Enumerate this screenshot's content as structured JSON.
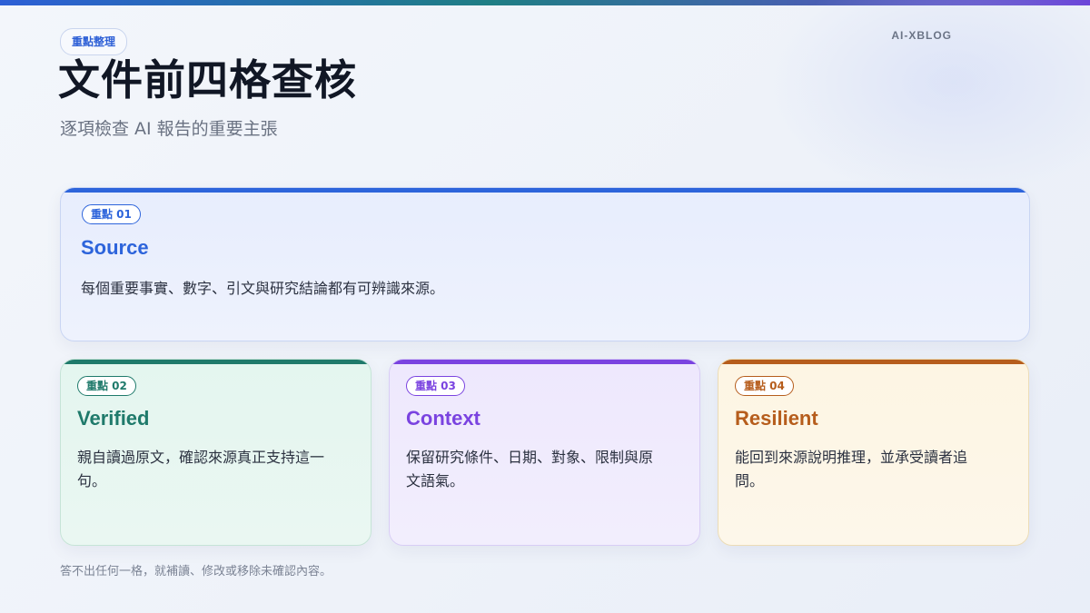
{
  "brand": "AI-XBLOG",
  "header": {
    "tag": "重點整理",
    "title": "文件前四格查核",
    "subtitle": "逐項檢查 AI 報告的重要主張"
  },
  "cards": [
    {
      "badge": "重點 01",
      "title": "Source",
      "desc": "每個重要事實、數字、引文與研究結論都有可辨識來源。",
      "color": "#2d64db"
    },
    {
      "badge": "重點 02",
      "title": "Verified",
      "desc": "親自讀過原文，確認來源真正支持這一句。",
      "color": "#1f7a6b"
    },
    {
      "badge": "重點 03",
      "title": "Context",
      "desc": "保留研究條件、日期、對象、限制與原文語氣。",
      "color": "#7a43e0"
    },
    {
      "badge": "重點 04",
      "title": "Resilient",
      "desc": "能回到來源說明推理，並承受讀者追問。",
      "color": "#b65d1c"
    }
  ],
  "footer": "答不出任何一格，就補讀、修改或移除未確認內容。"
}
